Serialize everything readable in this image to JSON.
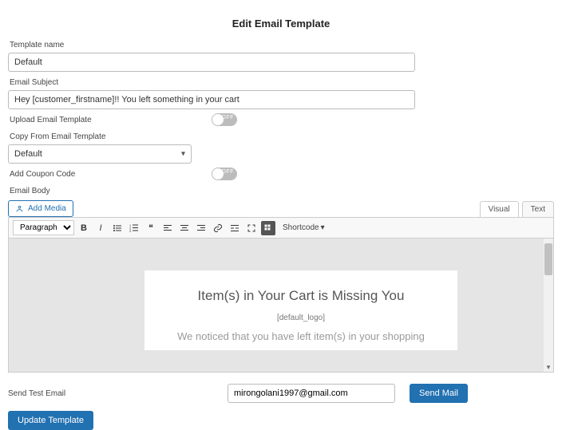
{
  "page": {
    "title": "Edit Email Template"
  },
  "labels": {
    "template_name": "Template name",
    "email_subject": "Email Subject",
    "upload_template": "Upload Email Template",
    "copy_from": "Copy From Email Template",
    "add_coupon": "Add Coupon Code",
    "email_body": "Email Body",
    "format_select": "Paragraph",
    "shortcode": "Shortcode",
    "send_test": "Send Test Email"
  },
  "fields": {
    "template_name_value": "Default",
    "email_subject_value": "Hey [customer_firstname]!! You left something in your cart",
    "copy_from_value": "Default",
    "test_email_value": "mirongolani1997@gmail.com"
  },
  "toggles": {
    "upload_off_label": "OFF",
    "coupon_off_label": "OFF"
  },
  "buttons": {
    "add_media": "Add Media",
    "visual_tab": "Visual",
    "text_tab": "Text",
    "send_mail": "Send Mail",
    "update_template": "Update Template"
  },
  "preview": {
    "heading": "Item(s) in Your Cart is Missing You",
    "logo_placeholder": "[default_logo]",
    "paragraph": "We noticed that you have left item(s) in your shopping"
  }
}
